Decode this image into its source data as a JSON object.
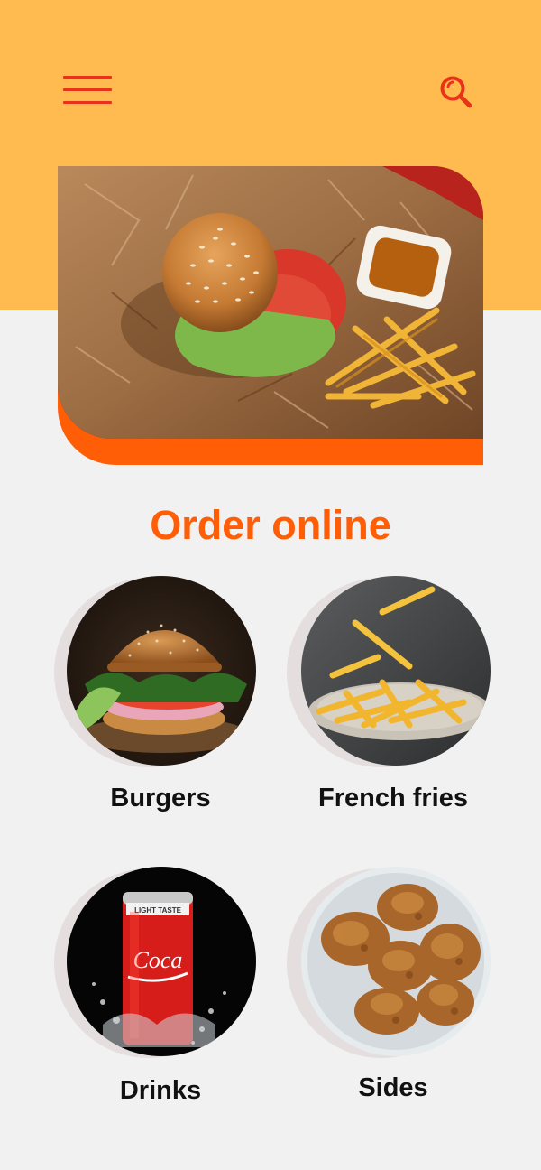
{
  "header": {
    "menu_icon": "hamburger-menu-icon",
    "search_icon": "search-icon",
    "background": "#ffbb4f",
    "icon_color": "#e8331a"
  },
  "hero": {
    "image": "burger-and-fries-photo",
    "accent": "#ff5e07"
  },
  "section": {
    "title": "Order online"
  },
  "categories": [
    {
      "label": "Burgers",
      "image": "burger-photo"
    },
    {
      "label": "French fries",
      "image": "french-fries-photo"
    },
    {
      "label": "Drinks",
      "image": "soda-can-photo"
    },
    {
      "label": "Sides",
      "image": "fried-chicken-photo"
    }
  ],
  "colors": {
    "page_background": "#f2f1f1",
    "title": "#ff5e07",
    "label": "#111111"
  }
}
